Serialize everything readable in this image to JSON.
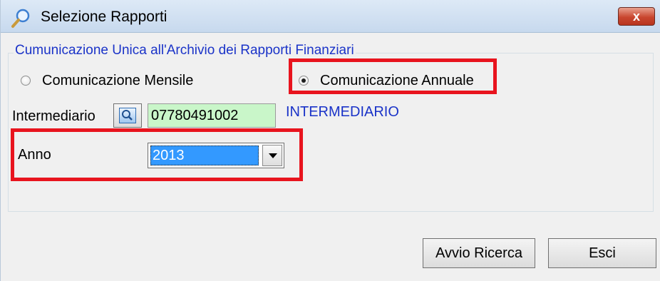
{
  "window": {
    "title": "Selezione Rapporti",
    "close_glyph": "x",
    "icon": "search-icon"
  },
  "group": {
    "legend": "Cumunicazione Unica all'Archivio dei Rapporti Finanziari"
  },
  "radios": [
    {
      "label": "Comunicazione Mensile",
      "checked": false
    },
    {
      "label": "Comunicazione Annuale",
      "checked": true
    }
  ],
  "intermediario": {
    "label": "Intermediario",
    "code": "07780491002",
    "name": "INTERMEDIARIO",
    "lookup_icon": "magnifier-icon"
  },
  "anno": {
    "label": "Anno",
    "selected": "2013"
  },
  "buttons": {
    "search": "Avvio Ricerca",
    "exit": "Esci"
  },
  "colors": {
    "highlight": "#e8141e",
    "legend_text": "#1a33c8",
    "code_field_bg": "#c9f6c9",
    "selection": "#3399ff"
  }
}
